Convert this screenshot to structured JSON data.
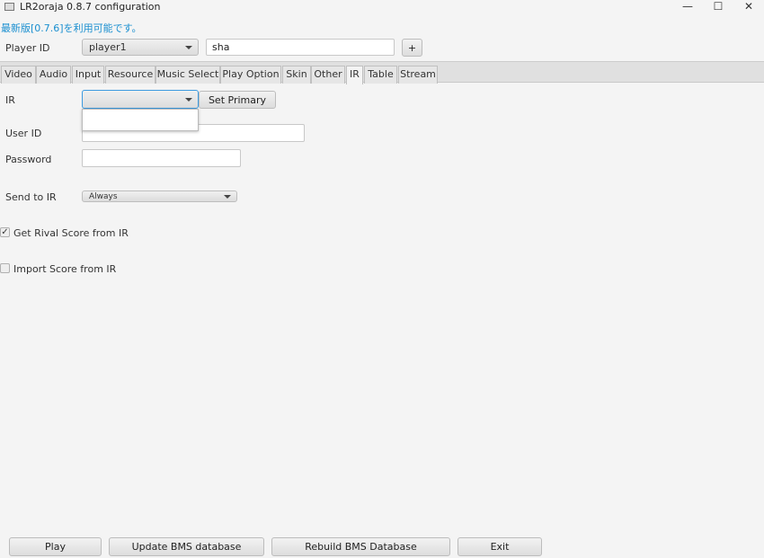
{
  "window": {
    "title": "LR2oraja 0.8.7 configuration",
    "minimize": "—",
    "maximize": "☐",
    "close": "✕"
  },
  "notice": "最新版[0.7.6]を利用可能です。",
  "player": {
    "label": "Player ID",
    "selected": "player1",
    "name_value": "sha",
    "add_label": "+"
  },
  "tabs": [
    "Video",
    "Audio",
    "Input",
    "Resource",
    "Music Select",
    "Play Option",
    "Skin",
    "Other",
    "IR",
    "Table",
    "Stream"
  ],
  "active_tab": "IR",
  "ir": {
    "label": "IR",
    "selected": "",
    "set_primary": "Set Primary",
    "user_id_label": "User ID",
    "user_id_value": "",
    "password_label": "Password",
    "password_value": "",
    "send_label": "Send to IR",
    "send_value": "Always",
    "rival_label": "Get Rival Score from IR",
    "rival_checked": true,
    "import_label": "Import Score from IR",
    "import_checked": false
  },
  "footer": {
    "play": "Play",
    "update": "Update BMS database",
    "rebuild": "Rebuild BMS Database",
    "exit": "Exit"
  }
}
